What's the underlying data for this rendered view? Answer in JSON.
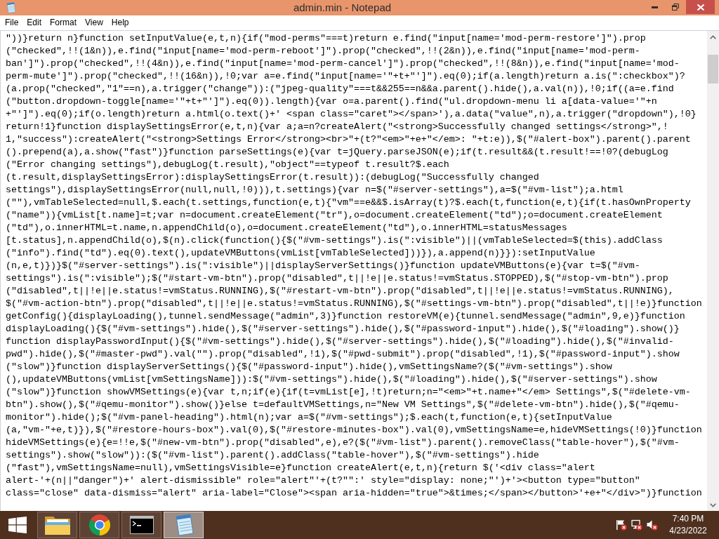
{
  "window": {
    "title": "admin.min - Notepad"
  },
  "menu": [
    "File",
    "Edit",
    "Format",
    "View",
    "Help"
  ],
  "document": {
    "lines": [
      "\"))}return n}function setInputValue(e,t,n){if(\"mod-perms\"===t)return e.find(\"input[name='mod-perm-restore']\").prop",
      "(\"checked\",!!(1&n)),e.find(\"input[name='mod-perm-reboot']\").prop(\"checked\",!!(2&n)),e.find(\"input[name='mod-perm-",
      "ban']\").prop(\"checked\",!!(4&n)),e.find(\"input[name='mod-perm-cancel']\").prop(\"checked\",!!(8&n)),e.find(\"input[name='mod-",
      "perm-mute']\").prop(\"checked\",!!(16&n)),!0;var a=e.find(\"input[name='\"+t+\"']\").eq(0);if(a.length)return a.is(\":checkbox\")?",
      "(a.prop(\"checked\",\"1\"==n),a.trigger(\"change\")):(\"jpeg-quality\"===t&&255==n&&a.parent().hide(),a.val(n)),!0;if((a=e.find",
      "(\"button.dropdown-toggle[name='\"+t+\"']\").eq(0)).length){var o=a.parent().find(\"ul.dropdown-menu li a[data-value='\"+n",
      "+\"']\").eq(0);if(o.length)return a.html(o.text()+' <span class=\"caret\"></span>'),a.data(\"value\",n),a.trigger(\"dropdown\"),!0}",
      "return!1}function displaySettingsError(e,t,n){var a;a=n?createAlert(\"<strong>Successfully changed settings</strong>\",!",
      "1,\"success\"):createAlert(\"<strong>Settings Error</strong><br>\"+(t?\"<em>\"+e+\"</em>: \"+t:e)),$(\"#alert-box\").parent().parent",
      "().prepend(a),a.show(\"fast\")}function parseSettings(e){var t=jQuery.parseJSON(e);if(t.result&&(t.result!==!0?(debugLog",
      "(\"Error changing settings\"),debugLog(t.result),\"object\"==typeof t.result?$.each",
      "(t.result,displaySettingsError):displaySettingsError(t.result)):(debugLog(\"Successfully changed",
      "settings\"),displaySettingsError(null,null,!0))),t.settings){var n=$(\"#server-settings\"),a=$(\"#vm-list\");a.html",
      "(\"\"),vmTableSelected=null,$.each(t.settings,function(e,t){\"vm\"==e&&$.isArray(t)?$.each(t,function(e,t){if(t.hasOwnProperty",
      "(\"name\")){vmList[t.name]=t;var n=document.createElement(\"tr\"),o=document.createElement(\"td\");o=document.createElement",
      "(\"td\"),o.innerHTML=t.name,n.appendChild(o),o=document.createElement(\"td\"),o.innerHTML=statusMessages",
      "[t.status],n.appendChild(o),$(n).click(function(){$(\"#vm-settings\").is(\":visible\")||(vmTableSelected=$(this).addClass",
      "(\"info\").find(\"td\").eq(0).text(),updateVMButtons(vmList[vmTableSelected]))}),a.append(n)}}):setInputValue",
      "(n,e,t)})}$(\"#server-settings\").is(\":visible\")||displayServerSettings()}function updateVMButtons(e){var t=$(\"#vm-",
      "settings\").is(\":visible\");$(\"#start-vm-btn\").prop(\"disabled\",t||!e||e.status!=vmStatus.STOPPED),$(\"#stop-vm-btn\").prop",
      "(\"disabled\",t||!e||e.status!=vmStatus.RUNNING),$(\"#restart-vm-btn\").prop(\"disabled\",t||!e||e.status!=vmStatus.RUNNING),",
      "$(\"#vm-action-btn\").prop(\"disabled\",t||!e||e.status!=vmStatus.RUNNING),$(\"#settings-vm-btn\").prop(\"disabled\",t||!e)}function",
      "getConfig(){displayLoading(),tunnel.sendMessage(\"admin\",3)}function restoreVM(e){tunnel.sendMessage(\"admin\",9,e)}function",
      "displayLoading(){$(\"#vm-settings\").hide(),$(\"#server-settings\").hide(),$(\"#password-input\").hide(),$(\"#loading\").show()}",
      "function displayPasswordInput(){$(\"#vm-settings\").hide(),$(\"#server-settings\").hide(),$(\"#loading\").hide(),$(\"#invalid-",
      "pwd\").hide(),$(\"#master-pwd\").val(\"\").prop(\"disabled\",!1),$(\"#pwd-submit\").prop(\"disabled\",!1),$(\"#password-input\").show",
      "(\"slow\")}function displayServerSettings(){$(\"#password-input\").hide(),vmSettingsName?($(\"#vm-settings\").show",
      "(),updateVMButtons(vmList[vmSettingsName])):$(\"#vm-settings\").hide(),$(\"#loading\").hide(),$(\"#server-settings\").show",
      "(\"slow\")}function showVMSettings(e){var t,n;if(e){if(t=vmList[e],!t)return;n=\"<em>\"+t.name+\"</em> Settings\",$(\"#delete-vm-",
      "btn\").show(),$(\"#qemu-monitor\").show()}else t=defaultVMSettings,n=\"New VM Settings\",$(\"#delete-vm-btn\").hide(),$(\"#qemu-",
      "monitor\").hide();$(\"#vm-panel-heading\").html(n);var a=$(\"#vm-settings\");$.each(t,function(e,t){setInputValue",
      "(a,\"vm-\"+e,t)}),$(\"#restore-hours-box\").val(0),$(\"#restore-minutes-box\").val(0),vmSettingsName=e,hideVMSettings(!0)}function",
      "hideVMSettings(e){e=!!e,$(\"#new-vm-btn\").prop(\"disabled\",e),e?($(\"#vm-list\").parent().removeClass(\"table-hover\"),$(\"#vm-",
      "settings\").show(\"slow\")):($(\"#vm-list\").parent().addClass(\"table-hover\"),$(\"#vm-settings\").hide",
      "(\"fast\"),vmSettingsName=null),vmSettingsVisible=e}function createAlert(e,t,n){return $('<div class=\"alert",
      "alert-'+(n||\"danger\")+' alert-dismissible\" role=\"alert\"'+(t?\"\":' style=\"display: none;\"')+'><button type=\"button\"",
      "class=\"close\" data-dismiss=\"alert\" aria-label=\"Close\"><span aria-hidden=\"true\">&times;</span></button>'+e+\"</div>\")}function"
    ]
  },
  "taskbar": {
    "apps": [
      {
        "kind": "explorer",
        "selected": false
      },
      {
        "kind": "browser",
        "selected": false
      },
      {
        "kind": "terminal",
        "selected": false
      },
      {
        "kind": "notepad",
        "selected": true
      }
    ],
    "clock": {
      "time": "7:40 PM",
      "date": "4/23/2022"
    }
  }
}
